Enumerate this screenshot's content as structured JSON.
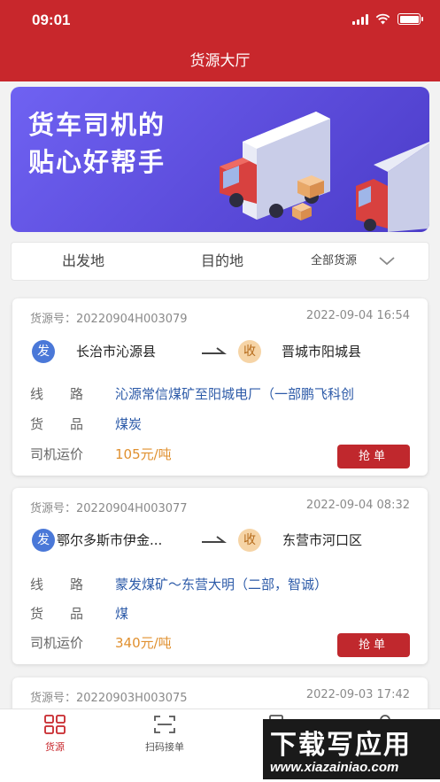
{
  "status_bar": {
    "time": "09:01"
  },
  "header": {
    "title": "货源大厅"
  },
  "banner": {
    "line1": "货车司机的",
    "line2": "贴心好帮手"
  },
  "filters": {
    "origin": "出发地",
    "destination": "目的地",
    "cargo_type": "全部货源"
  },
  "labels": {
    "from_tag": "发",
    "to_tag": "收",
    "route": "线　　路",
    "goods": "货　　品",
    "freight": "司机运价",
    "grab": "抢单"
  },
  "cards": [
    {
      "no": "货源号：20220904H003079",
      "time": "2022-09-04 16:54",
      "from": "长治市沁源县",
      "to": "晋城市阳城县",
      "route": "沁源常信煤矿至阳城电厂（一部鹏飞科创",
      "goods": "煤炭",
      "price": "105元/吨"
    },
    {
      "no": "货源号：20220904H003077",
      "time": "2022-09-04 08:32",
      "from": "鄂尔多斯市伊金...",
      "to": "东营市河口区",
      "route": "蒙发煤矿～东营大明（二部，智诚）",
      "goods": "煤",
      "price": "340元/吨"
    },
    {
      "no": "货源号：20220903H003075",
      "time": "2022-09-03 17:42"
    }
  ],
  "tabbar": {
    "items": [
      "货源",
      "扫码接单"
    ]
  },
  "watermark": {
    "title": "下载写应用",
    "url": "www.xiazainiao.com"
  },
  "theme": {
    "primary": "#c8272c",
    "link": "#2c5aa8",
    "price": "#e0902f",
    "banner": "#6054e6"
  }
}
